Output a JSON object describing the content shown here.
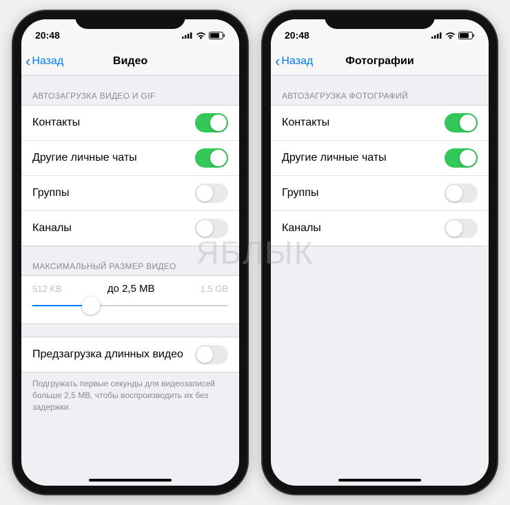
{
  "status": {
    "time": "20:48"
  },
  "phones": [
    {
      "back": "Назад",
      "title": "Видео",
      "section1": "АВТОЗАГРУЗКА ВИДЕО И GIF",
      "rows": [
        {
          "label": "Контакты",
          "on": true
        },
        {
          "label": "Другие личные чаты",
          "on": true
        },
        {
          "label": "Группы",
          "on": false
        },
        {
          "label": "Каналы",
          "on": false
        }
      ],
      "section2": "МАКСИМАЛЬНЫЙ РАЗМЕР ВИДЕО",
      "slider": {
        "min": "512 KB",
        "max": "1,5 GB",
        "value": "до 2,5 MB"
      },
      "preload": {
        "label": "Предзагрузка длинных видео",
        "on": false
      },
      "footnote": "Подгружать первые секунды для видеозаписей больше 2,5 MB, чтобы воспроизводить их без задержки."
    },
    {
      "back": "Назад",
      "title": "Фотографии",
      "section1": "АВТОЗАГРУЗКА ФОТОГРАФИЙ",
      "rows": [
        {
          "label": "Контакты",
          "on": true
        },
        {
          "label": "Другие личные чаты",
          "on": true
        },
        {
          "label": "Группы",
          "on": false
        },
        {
          "label": "Каналы",
          "on": false
        }
      ]
    }
  ]
}
